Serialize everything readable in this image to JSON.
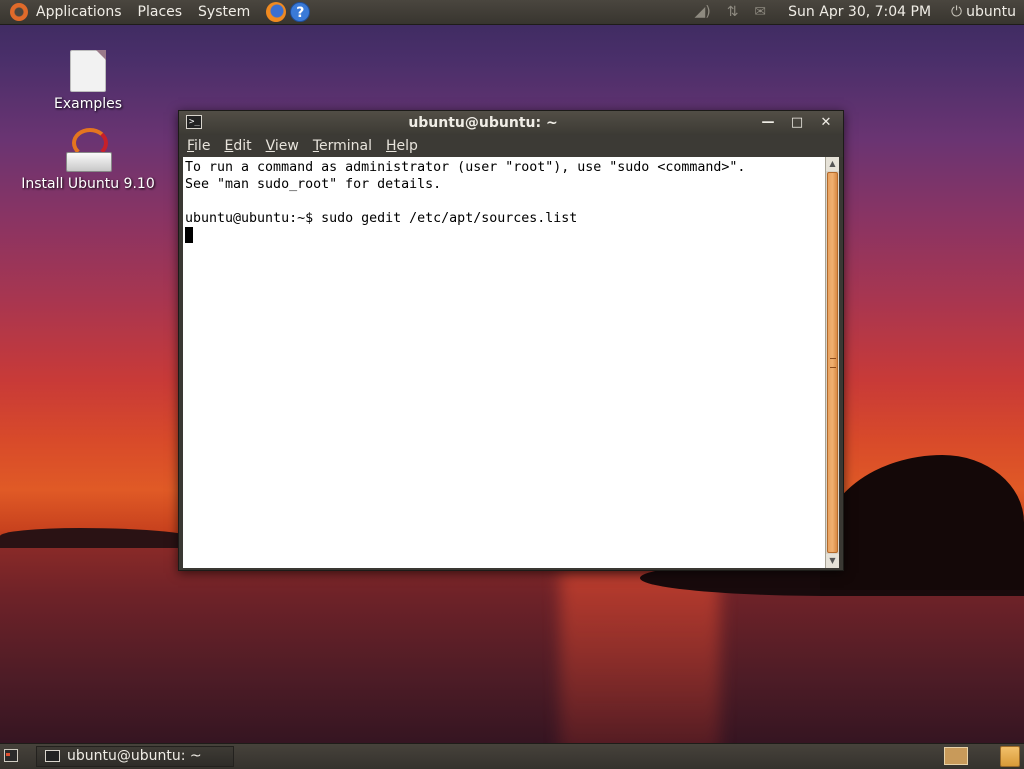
{
  "top_panel": {
    "menus": [
      "Applications",
      "Places",
      "System"
    ],
    "clock": "Sun Apr 30,  7:04 PM",
    "user": "ubuntu"
  },
  "icons": {
    "ubuntu_logo": "ubuntu-logo-icon",
    "firefox": "firefox-icon",
    "help": "help-icon",
    "volume": "volume-icon",
    "network": "network-icon",
    "mail": "mail-icon",
    "power": "power-icon",
    "terminal": "terminal-icon",
    "trash": "trash-icon"
  },
  "help_glyph": "?",
  "desktop": {
    "icons": [
      {
        "label": "Examples"
      },
      {
        "label": "Install Ubuntu 9.10"
      }
    ]
  },
  "window": {
    "title": "ubuntu@ubuntu: ~",
    "menu": [
      {
        "ul": "F",
        "rest": "ile"
      },
      {
        "ul": "E",
        "rest": "dit"
      },
      {
        "ul": "V",
        "rest": "iew"
      },
      {
        "ul": "T",
        "rest": "erminal"
      },
      {
        "ul": "H",
        "rest": "elp"
      }
    ],
    "lines": [
      "To run a command as administrator (user \"root\"), use \"sudo <command>\".",
      "See \"man sudo_root\" for details.",
      "",
      "ubuntu@ubuntu:~$ sudo gedit /etc/apt/sources.list"
    ]
  },
  "taskbar": {
    "items": [
      {
        "label": "ubuntu@ubuntu: ~"
      }
    ]
  },
  "colors": {
    "panel": "#3c3a35",
    "terminal_bg": "#ffffff",
    "scrollbar_thumb": "#e8a260",
    "ubuntu_orange": "#e06a2a"
  }
}
